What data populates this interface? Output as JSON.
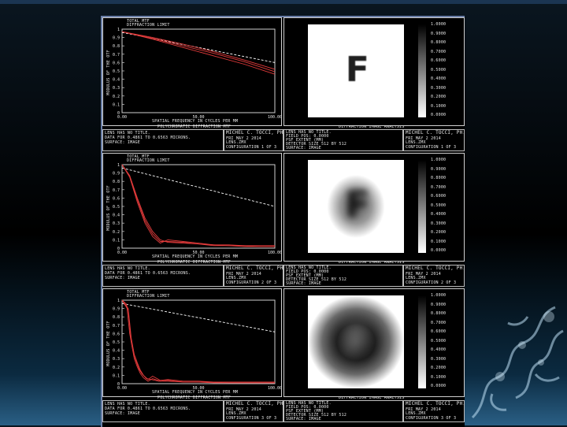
{
  "rows": [
    {
      "plot": {
        "header": [
          "TOTAL MTF",
          "DIFFRACTION LIMIT"
        ],
        "yticks": [
          "1",
          "0.9",
          "0.8",
          "0.7",
          "0.6",
          "0.5",
          "0.4",
          "0.3",
          "0.2",
          "0.1",
          "0"
        ],
        "xticks": [
          "0.00",
          "50.00",
          "100.00"
        ],
        "xlabel": "SPATIAL FREQUENCY IN CYCLES PER MM",
        "ylabel": "MODULUS OF THE OTF"
      },
      "plot_caption": "POLYCHROMATIC DIFFRACTION MTF",
      "image_caption": "DIFFRACTION IMAGE ANALYSIS",
      "plot_info": [
        "LENS HAS NO TITLE.",
        "DATA FOR 0.4861 TO 0.6563 MICRONS.",
        "SURFACE: IMAGE"
      ],
      "plot_stamp": [
        "MICHEL C. TOCCI, PH.D.",
        "FRI MAY 2 2014",
        "LENS.ZMX",
        "CONFIGURATION 1 OF 3"
      ],
      "image_info": [
        "LENS HAS NO TITLE.",
        "FIELD POS: 0.0000",
        "PSF EXTENT (MM)",
        "DETECTOR SIZE 512 BY 512",
        "SURFACE: IMAGE"
      ],
      "image_stamp": [
        "MICHEL C. TOCCI, PH.D.",
        "FRI MAY 2 2014",
        "LENS.ZMX",
        "CONFIGURATION 1 OF 3"
      ],
      "image_glyph": "F",
      "scale_labels": [
        "1.0000",
        "0.9000",
        "0.8000",
        "0.7000",
        "0.6000",
        "0.5000",
        "0.4000",
        "0.3000",
        "0.2000",
        "0.1000",
        "0.0000"
      ]
    },
    {
      "plot": {
        "header": [
          "TOTAL MTF",
          "DIFFRACTION LIMIT"
        ],
        "yticks": [
          "1",
          "0.9",
          "0.8",
          "0.7",
          "0.6",
          "0.5",
          "0.4",
          "0.3",
          "0.2",
          "0.1",
          "0"
        ],
        "xticks": [
          "0.00",
          "50.00",
          "100.00"
        ],
        "xlabel": "SPATIAL FREQUENCY IN CYCLES PER MM",
        "ylabel": "MODULUS OF THE OTF"
      },
      "plot_caption": "POLYCHROMATIC DIFFRACTION MTF",
      "image_caption": "DIFFRACTION IMAGE ANALYSIS",
      "plot_info": [
        "LENS HAS NO TITLE.",
        "DATA FOR 0.4861 TO 0.6563 MICRONS.",
        "SURFACE: IMAGE"
      ],
      "plot_stamp": [
        "MICHEL C. TOCCI, PH.D.",
        "FRI MAY 2 2014",
        "LENS.ZMX",
        "CONFIGURATION 2 OF 3"
      ],
      "image_info": [
        "LENS HAS NO TITLE.",
        "FIELD POS: 0.0000",
        "PSF EXTENT (MM)",
        "DETECTOR SIZE 512 BY 512",
        "SURFACE: IMAGE"
      ],
      "image_stamp": [
        "MICHEL C. TOCCI, PH.D.",
        "FRI MAY 2 2014",
        "LENS.ZMX",
        "CONFIGURATION 2 OF 3"
      ],
      "image_glyph": "F",
      "scale_labels": [
        "1.0000",
        "0.9000",
        "0.8000",
        "0.7000",
        "0.6000",
        "0.5000",
        "0.4000",
        "0.3000",
        "0.2000",
        "0.1000",
        "0.0000"
      ]
    },
    {
      "plot": {
        "header": [
          "TOTAL MTF",
          "DIFFRACTION LIMIT"
        ],
        "yticks": [
          "1",
          "0.9",
          "0.8",
          "0.7",
          "0.6",
          "0.5",
          "0.4",
          "0.3",
          "0.2",
          "0.1",
          "0"
        ],
        "xticks": [
          "0.00",
          "50.00",
          "100.00"
        ],
        "xlabel": "SPATIAL FREQUENCY IN CYCLES PER MM",
        "ylabel": "MODULUS OF THE OTF"
      },
      "plot_caption": "POLYCHROMATIC DIFFRACTION MTF",
      "image_caption": "DIFFRACTION IMAGE ANALYSIS",
      "plot_info": [
        "LENS HAS NO TITLE.",
        "DATA FOR 0.4861 TO 0.6563 MICRONS.",
        "SURFACE: IMAGE"
      ],
      "plot_stamp": [
        "MICHEL C. TOCCI, PH.D.",
        "FRI MAY 2 2014",
        "LENS.ZMX",
        "CONFIGURATION 3 OF 3"
      ],
      "image_info": [
        "LENS HAS NO TITLE.",
        "FIELD POS: 0.0000",
        "PSF EXTENT (MM)",
        "DETECTOR SIZE 512 BY 512",
        "SURFACE: IMAGE"
      ],
      "image_stamp": [
        "MICHEL C. TOCCI, PH.D.",
        "FRI MAY 2 2014",
        "LENS.ZMX",
        "CONFIGURATION 3 OF 3"
      ],
      "image_glyph": "F",
      "scale_labels": [
        "1.0000",
        "0.9000",
        "0.8000",
        "0.7000",
        "0.6000",
        "0.5000",
        "0.4000",
        "0.3000",
        "0.2000",
        "0.1000",
        "0.0000"
      ]
    }
  ],
  "chart_data": [
    {
      "type": "line",
      "xlim": [
        0,
        100
      ],
      "ylim": [
        0,
        1
      ],
      "series": [
        {
          "name": "DIFFRACTION LIMIT",
          "color": "#ffffff",
          "x": [
            0,
            100
          ],
          "y": [
            0.96,
            0.6
          ]
        },
        {
          "color": "#e03a3a",
          "x": [
            0,
            20,
            40,
            60,
            80,
            100
          ],
          "y": [
            0.97,
            0.9,
            0.82,
            0.73,
            0.63,
            0.52
          ]
        },
        {
          "color": "#e03a3a",
          "x": [
            0,
            20,
            40,
            60,
            80,
            100
          ],
          "y": [
            0.97,
            0.89,
            0.8,
            0.71,
            0.61,
            0.49
          ]
        },
        {
          "color": "#e03a3a",
          "x": [
            0,
            20,
            40,
            60,
            80,
            100
          ],
          "y": [
            0.97,
            0.88,
            0.78,
            0.68,
            0.58,
            0.46
          ]
        }
      ]
    },
    {
      "type": "line",
      "xlim": [
        0,
        100
      ],
      "ylim": [
        0,
        1
      ],
      "series": [
        {
          "name": "DIFFRACTION LIMIT",
          "color": "#ffffff",
          "x": [
            0,
            100
          ],
          "y": [
            0.96,
            0.5
          ]
        },
        {
          "color": "#e03a3a",
          "x": [
            0,
            5,
            10,
            15,
            20,
            25,
            30,
            40,
            50,
            60,
            70,
            80,
            90,
            100
          ],
          "y": [
            1.0,
            0.85,
            0.55,
            0.3,
            0.14,
            0.06,
            0.1,
            0.08,
            0.06,
            0.04,
            0.04,
            0.03,
            0.03,
            0.03
          ]
        },
        {
          "color": "#e03a3a",
          "x": [
            0,
            5,
            10,
            15,
            20,
            25,
            30,
            40,
            50,
            60,
            70,
            80,
            90,
            100
          ],
          "y": [
            1.0,
            0.86,
            0.58,
            0.33,
            0.17,
            0.08,
            0.08,
            0.07,
            0.05,
            0.04,
            0.03,
            0.03,
            0.02,
            0.02
          ]
        },
        {
          "color": "#e03a3a",
          "x": [
            0,
            5,
            10,
            15,
            20,
            25,
            30,
            40,
            50,
            60,
            70,
            80,
            90,
            100
          ],
          "y": [
            1.0,
            0.87,
            0.6,
            0.36,
            0.2,
            0.1,
            0.07,
            0.06,
            0.05,
            0.03,
            0.03,
            0.02,
            0.02,
            0.02
          ]
        }
      ]
    },
    {
      "type": "line",
      "xlim": [
        0,
        100
      ],
      "ylim": [
        0,
        1
      ],
      "series": [
        {
          "name": "DIFFRACTION LIMIT",
          "color": "#ffffff",
          "x": [
            0,
            100
          ],
          "y": [
            0.96,
            0.62
          ]
        },
        {
          "color": "#e03a3a",
          "x": [
            0,
            4,
            6,
            8,
            10,
            12,
            14,
            17,
            20,
            25,
            30,
            40,
            50,
            60,
            70,
            80,
            90,
            100
          ],
          "y": [
            1.0,
            0.9,
            0.55,
            0.35,
            0.25,
            0.16,
            0.1,
            0.05,
            0.09,
            0.04,
            0.05,
            0.03,
            0.03,
            0.02,
            0.02,
            0.02,
            0.02,
            0.02
          ]
        },
        {
          "color": "#e03a3a",
          "x": [
            0,
            4,
            6,
            8,
            10,
            12,
            14,
            17,
            20,
            25,
            30,
            40,
            50,
            60,
            70,
            80,
            90,
            100
          ],
          "y": [
            1.0,
            0.88,
            0.5,
            0.3,
            0.2,
            0.12,
            0.07,
            0.03,
            0.06,
            0.03,
            0.04,
            0.02,
            0.02,
            0.02,
            0.01,
            0.01,
            0.01,
            0.01
          ]
        },
        {
          "color": "#e03a3a",
          "x": [
            0,
            3,
            5,
            7,
            9,
            11,
            13,
            16,
            19,
            24,
            30,
            40,
            50,
            60,
            70,
            80,
            90,
            100
          ],
          "y": [
            1.0,
            0.95,
            0.6,
            0.4,
            0.28,
            0.18,
            0.12,
            0.06,
            0.05,
            0.03,
            0.03,
            0.02,
            0.02,
            0.01,
            0.01,
            0.01,
            0.01,
            0.01
          ]
        }
      ]
    }
  ]
}
